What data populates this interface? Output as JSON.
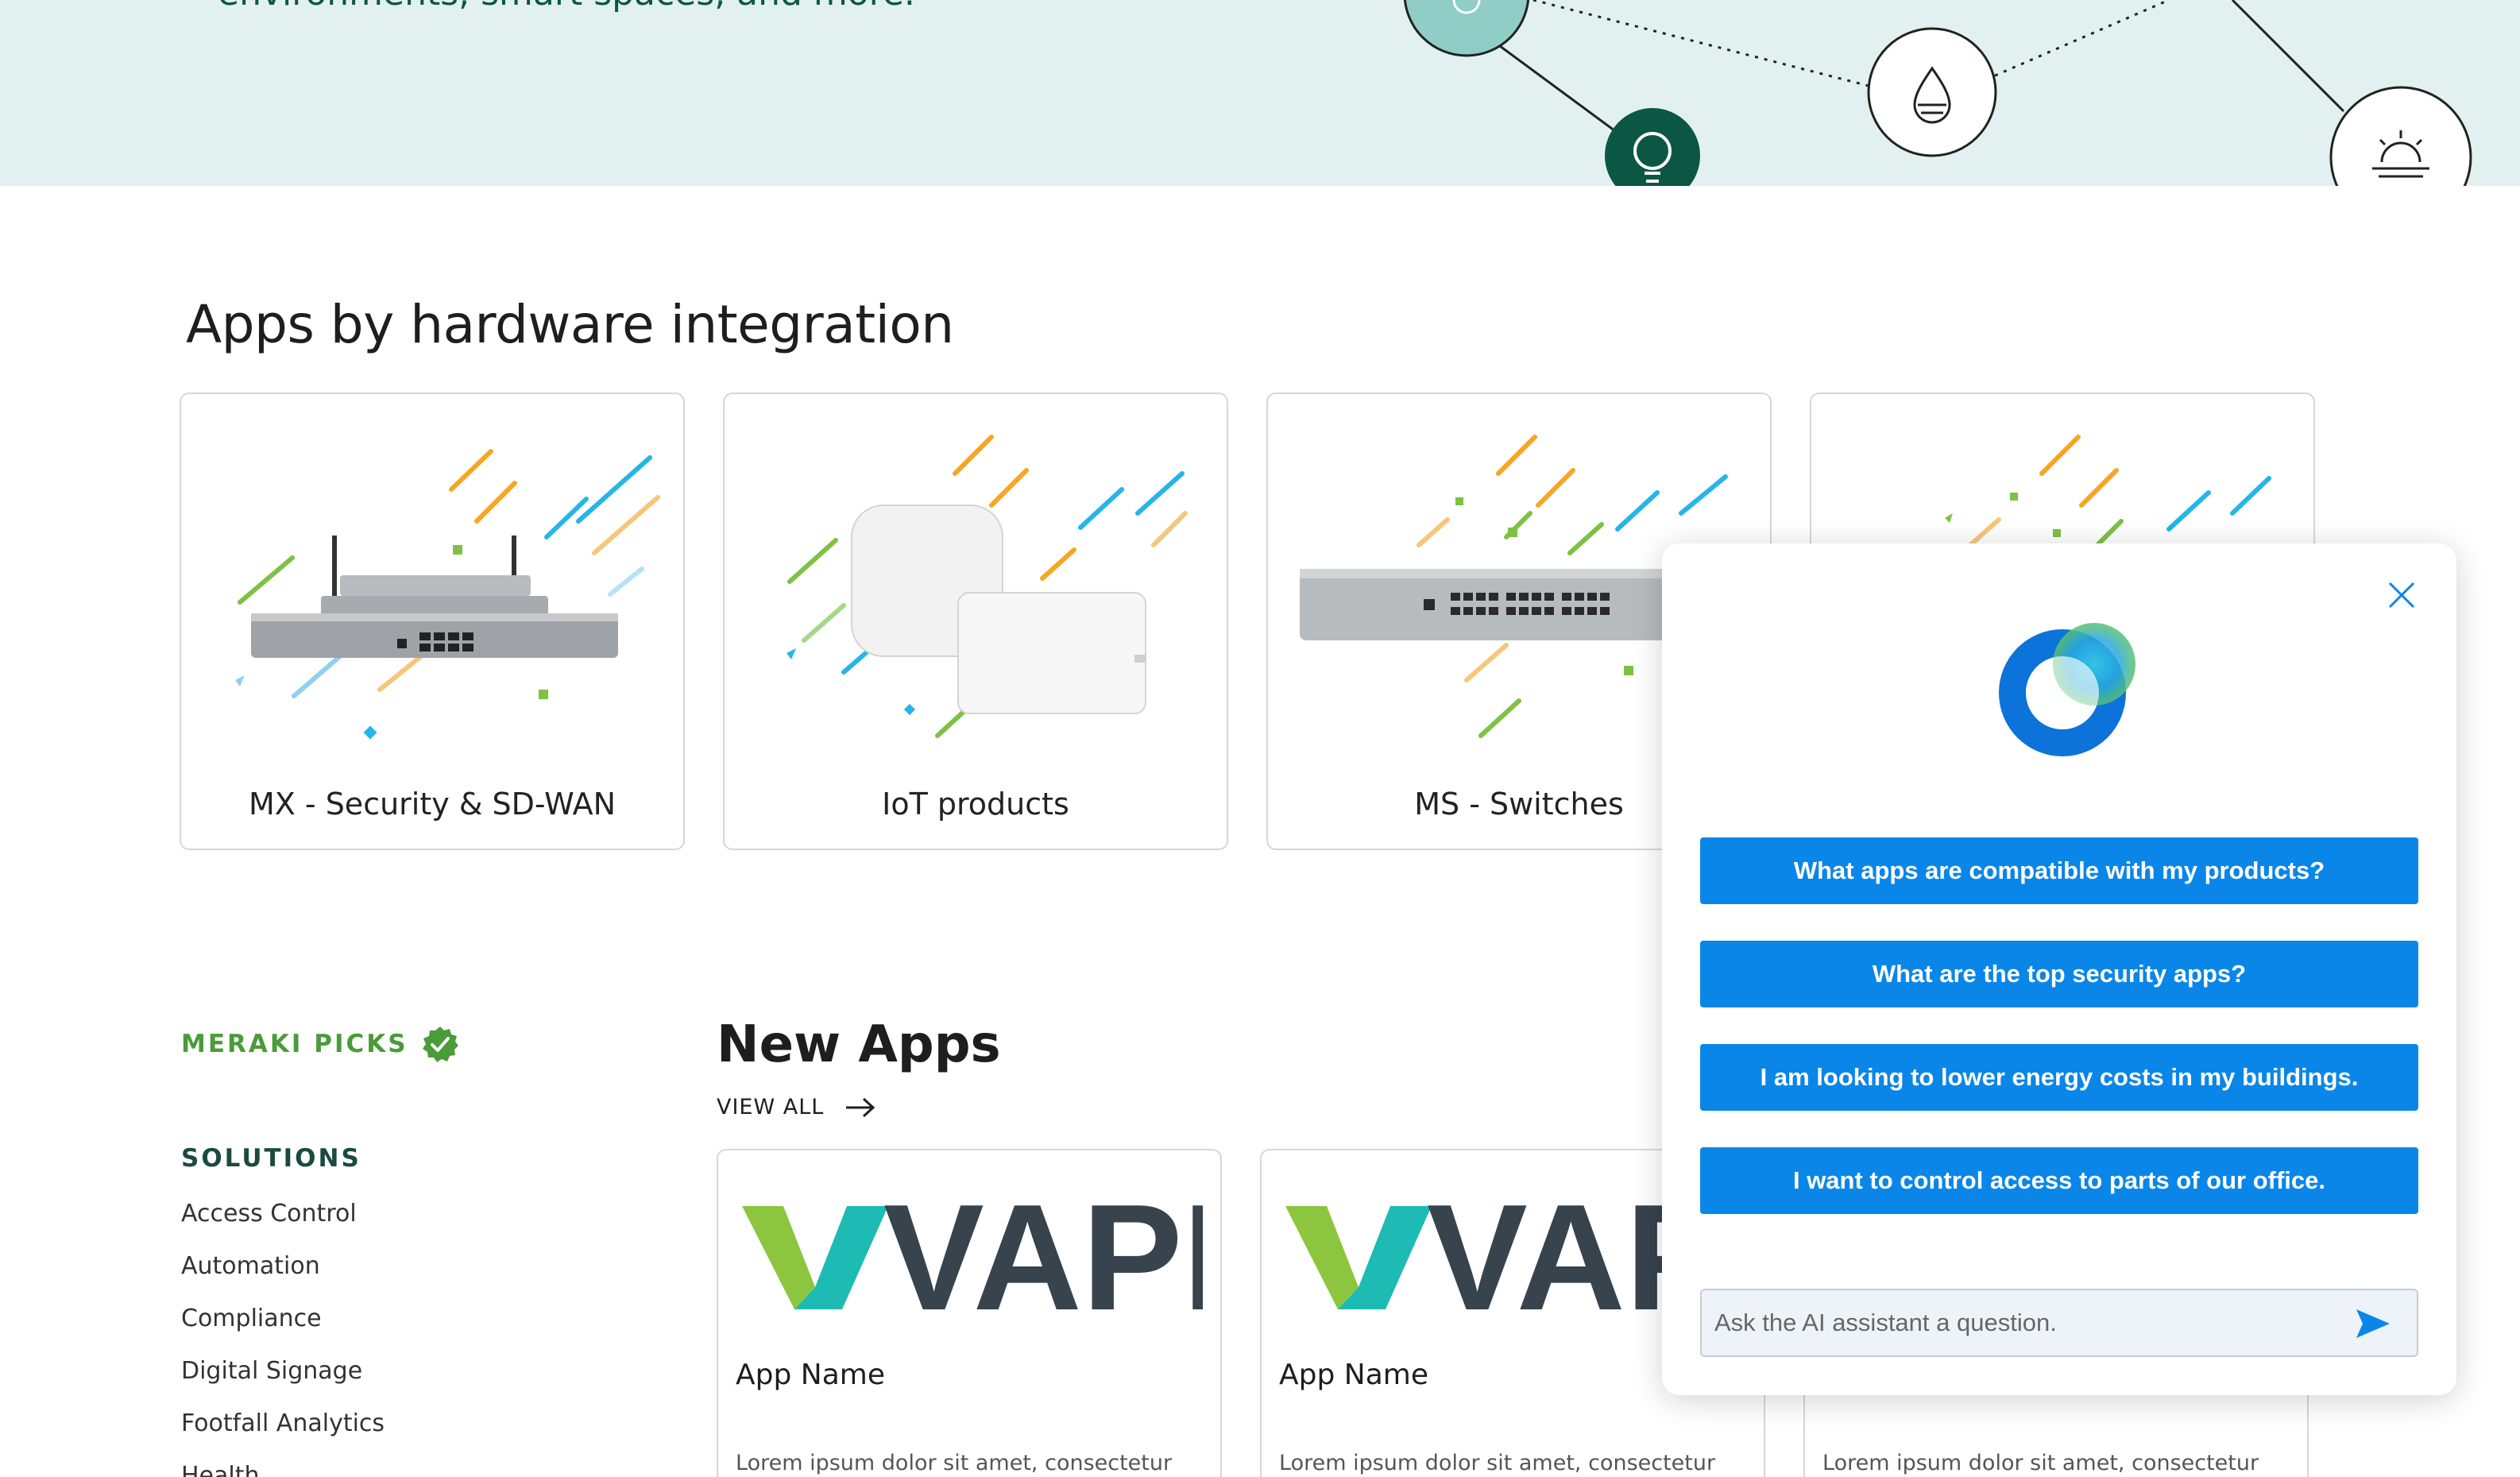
{
  "hero": {
    "text": "environments, smart spaces, and more."
  },
  "hardware": {
    "title": "Apps by hardware integration",
    "cards": [
      {
        "label": "MX - Security & SD-WAN"
      },
      {
        "label": "IoT products"
      },
      {
        "label": "MS - Switches"
      },
      {
        "label": ""
      }
    ]
  },
  "sidebar": {
    "picks_label": "MERAKI PICKS",
    "solutions_heading": "SOLUTIONS",
    "solutions": [
      "Access Control",
      "Automation",
      "Compliance",
      "Digital Signage",
      "Footfall Analytics",
      "Health"
    ]
  },
  "new_apps": {
    "title": "New Apps",
    "view_all": "VIEW ALL",
    "logo_text": "VAPP",
    "apps": [
      {
        "name": "App Name",
        "desc": "Lorem ipsum dolor sit amet, consectetur"
      },
      {
        "name": "App Name",
        "desc": "Lorem ipsum dolor sit amet, consectetur"
      },
      {
        "name": "",
        "desc": "Lorem ipsum dolor sit amet, consectetur"
      }
    ]
  },
  "chat": {
    "suggestions": [
      "What apps are compatible with my products?",
      "What are the top security apps?",
      "I am looking to lower energy costs in my buildings.",
      "I want to control access to parts of our office."
    ],
    "input_placeholder": "Ask the AI assistant a question."
  },
  "colors": {
    "hero_bg": "#e2f1f0",
    "brand_green": "#4a9b3a",
    "dark_green": "#0b5744",
    "accent_blue": "#0a86e8"
  },
  "icons": [
    "droplet-icon",
    "lightbulb-icon",
    "sunrise-icon",
    "verified-badge-icon",
    "arrow-right-icon",
    "close-icon",
    "send-icon",
    "ai-assistant-logo"
  ]
}
